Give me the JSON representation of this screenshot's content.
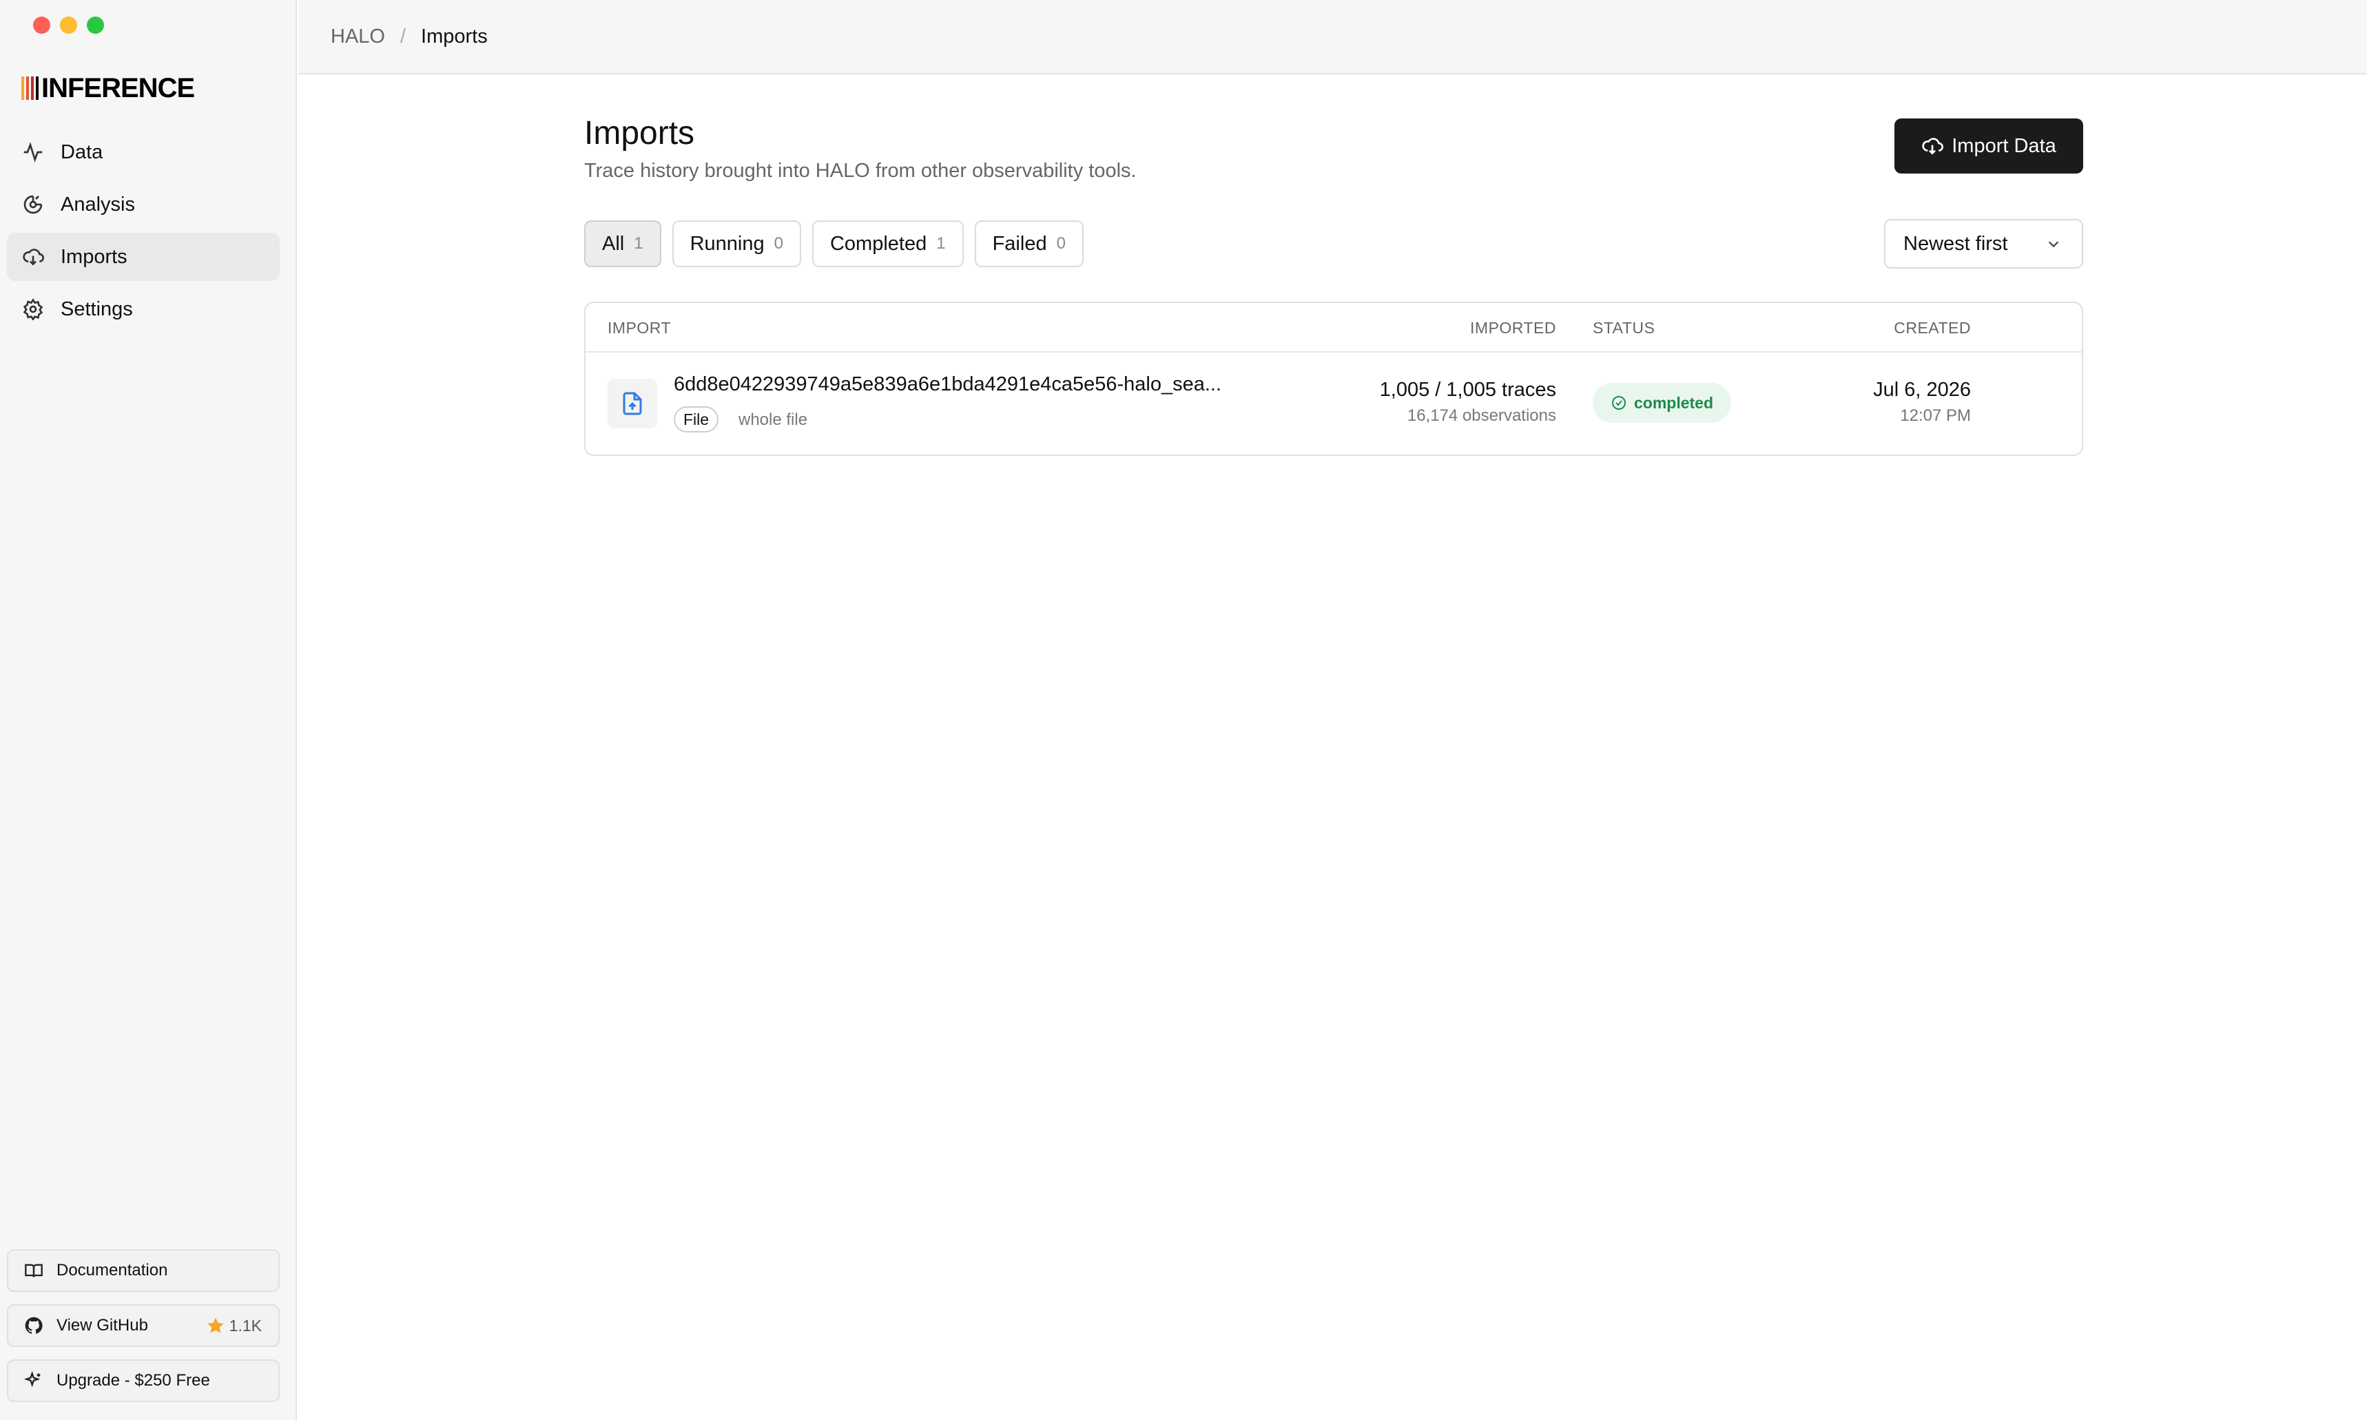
{
  "app": {
    "logo_text": "INFERENCE",
    "logo_bar_colors": [
      "#f5a623",
      "#e8502d",
      "#b8322b",
      "#000000"
    ]
  },
  "sidebar": {
    "items": [
      {
        "label": "Data",
        "icon": "activity-icon"
      },
      {
        "label": "Analysis",
        "icon": "analysis-icon"
      },
      {
        "label": "Imports",
        "icon": "cloud-download-icon",
        "active": true
      },
      {
        "label": "Settings",
        "icon": "gear-icon"
      }
    ],
    "footer": {
      "documentation": "Documentation",
      "github": "View GitHub",
      "github_stars": "1.1K",
      "upgrade": "Upgrade - $250 Free"
    }
  },
  "breadcrumb": {
    "root": "HALO",
    "separator": "/",
    "current": "Imports"
  },
  "page": {
    "title": "Imports",
    "subtitle": "Trace history brought into HALO from other observability tools.",
    "import_button": "Import Data"
  },
  "filters": [
    {
      "label": "All",
      "count": "1",
      "active": true
    },
    {
      "label": "Running",
      "count": "0"
    },
    {
      "label": "Completed",
      "count": "1"
    },
    {
      "label": "Failed",
      "count": "0"
    }
  ],
  "sort": {
    "selected": "Newest first"
  },
  "table": {
    "headers": {
      "import": "IMPORT",
      "imported": "IMPORTED",
      "status": "STATUS",
      "created": "CREATED"
    },
    "rows": [
      {
        "name": "6dd8e0422939749a5e839a6e1bda4291e4ca5e56-halo_sea...",
        "source_tag": "File",
        "scope": "whole file",
        "imported": "1,005 / 1,005 traces",
        "observations": "16,174 observations",
        "status": "completed",
        "created_date": "Jul 6, 2026",
        "created_time": "12:07 PM"
      }
    ]
  },
  "colors": {
    "accent_button": "#1b1b1b",
    "status_completed": "#1c8c4a",
    "status_completed_bg": "#e9f6ee",
    "file_icon": "#2f7be0",
    "star": "#f5a623"
  }
}
